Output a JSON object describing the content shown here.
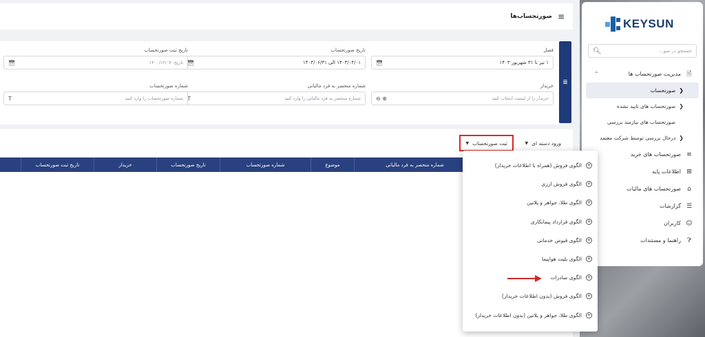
{
  "app": {
    "logo_text": "KEYSUN",
    "page_title": "صورتحساب‌ها"
  },
  "sidebar": {
    "search_placeholder": "جستجو در منو...",
    "group_header": "مدیریت صورتحساب ها",
    "sub_items": [
      {
        "label": "صورتحساب",
        "active": true
      },
      {
        "label": "صورتحساب های تایید نشده"
      },
      {
        "label": "صورتحساب های نیازمند بررسی"
      },
      {
        "label": "درحال بررسی توسط شرکت معتمد"
      }
    ],
    "items": [
      {
        "label": "صورتحساب های خرید",
        "icon": "list-icon"
      },
      {
        "label": "اطلاعات پایه",
        "icon": "grid-icon"
      },
      {
        "label": "صورتحساب های مالیات",
        "icon": "home-icon"
      },
      {
        "label": "گزارشات",
        "icon": "report-icon"
      },
      {
        "label": "کاربران",
        "icon": "user-icon"
      },
      {
        "label": "راهنما و مستندات",
        "icon": "help-icon"
      }
    ]
  },
  "filters": {
    "season": {
      "label": "فصل",
      "value": "۱ تیر تا ۳۱ شهریور ۱۴۰۳"
    },
    "invoice_date": {
      "label": "تاریخ صورتحساب",
      "value": "۱۴۰۳/۰۴/۰۱ الی ۱۴۰۳/۰۶/۳۱"
    },
    "register_date": {
      "label": "تاریخ ثبت صورتحساب",
      "placeholder": "تاریخ: ۱۴۰۰/۱۲/۰۷"
    },
    "buyer": {
      "label": "خریدار",
      "placeholder": "خریدار را از لیست انتخاب کنید"
    },
    "fiscal_number": {
      "label": "شماره منحصر به فرد مالیاتی",
      "placeholder": "شماره منحصر به فرد مالیاتی را وارد کنید"
    },
    "invoice_number": {
      "label": "شماره صورتحساب",
      "placeholder": "شماره صورتحساب را وارد کنید"
    }
  },
  "toolbar": {
    "register_label": "ثبت صورتحساب",
    "bulk_label": "ورود دسته ای"
  },
  "table": {
    "columns": [
      "شماره منحصر به فرد مالیاتی",
      "موضوع",
      "شماره صورتحساب",
      "تاریخ صورتحساب",
      "خریدار",
      "تاریخ ثبت صورتحساب"
    ]
  },
  "dropdown": {
    "items": [
      "الگوی فروش (همراه با اطلاعات خریدار)",
      "الگوی فروش ارزی",
      "الگوی طلا، جواهر و پلاتین",
      "الگوی قرارداد پیمانکاری",
      "الگوی قبوض خدماتی",
      "الگوی بلیت هواپیما",
      "الگوی صادرات",
      "الگوی فروش (بدون اطلاعات خریدار)",
      "الگوی طلا، جواهر و پلاتین (بدون اطلاعات خریدار)"
    ]
  },
  "colors": {
    "primary": "#1e3a78",
    "table_header": "#2a4180",
    "highlight": "#d62a2a"
  }
}
